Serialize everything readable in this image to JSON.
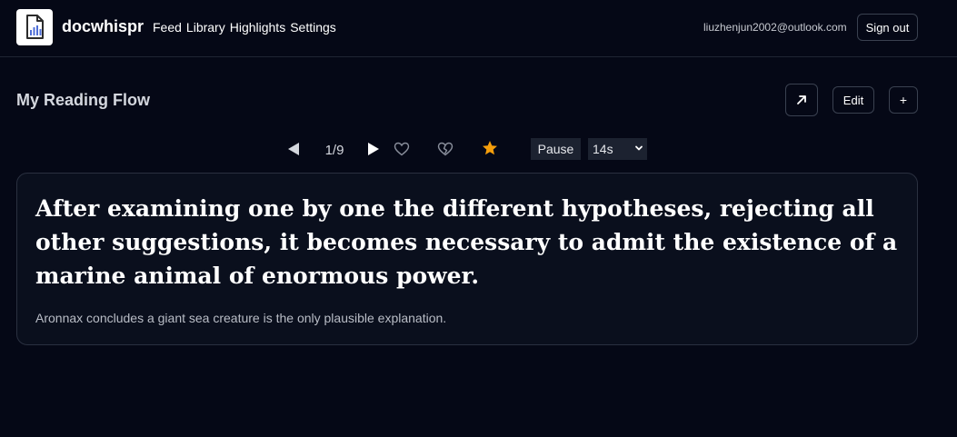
{
  "app": {
    "name": "docwhispr",
    "logo_icon": "document-audio-icon"
  },
  "nav": {
    "items": [
      "Feed",
      "Library",
      "Highlights",
      "Settings"
    ]
  },
  "user": {
    "email": "liuzhenjun2002@outlook.com",
    "signout_label": "Sign out"
  },
  "page": {
    "title": "My Reading Flow",
    "open_icon": "arrow-up-right-icon",
    "edit_label": "Edit",
    "add_label": "+"
  },
  "player": {
    "counter": "1/9",
    "pause_label": "Pause",
    "speed": "14s",
    "star_color": "#f59e0b"
  },
  "card": {
    "quote": "After examining one by one the different hypotheses, rejecting all other suggestions, it becomes necessary to admit the existence of a marine animal of enormous power.",
    "summary": "Aronnax concludes a giant sea creature is the only plausible explanation."
  }
}
